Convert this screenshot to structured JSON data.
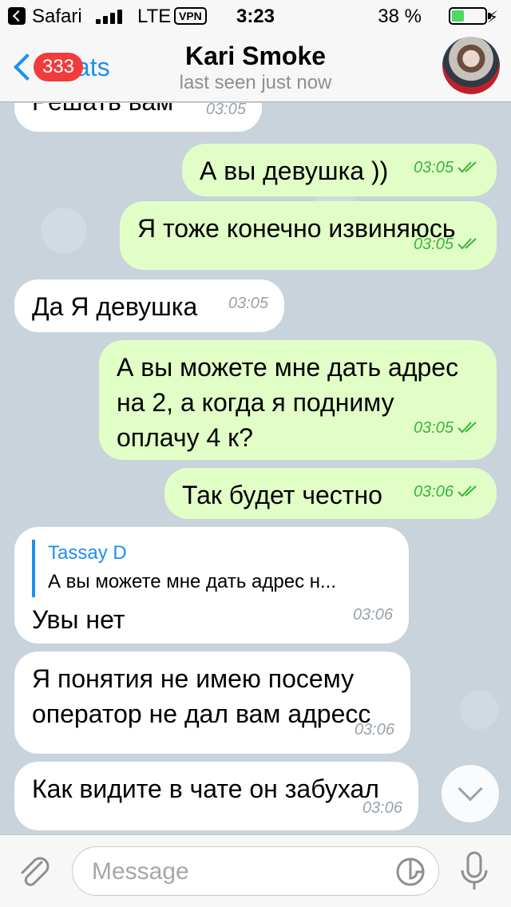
{
  "status_bar": {
    "app": "Safari",
    "network": "LTE",
    "vpn": "VPN",
    "time": "3:23",
    "battery_percent": "38 %",
    "battery_level": 0.38,
    "icons": [
      "back-to-app-icon",
      "signal-icon",
      "battery-icon",
      "charging-icon"
    ]
  },
  "nav": {
    "back_label": "Chats",
    "badge": "333",
    "title": "Kari Smoke",
    "subtitle": "last seen just now"
  },
  "messages": [
    {
      "dir": "in",
      "text": "Решать вам",
      "time": "03:05"
    },
    {
      "dir": "out",
      "text": "А вы девушка ))",
      "time": "03:05"
    },
    {
      "dir": "out",
      "text": "Я тоже конечно извиняюсь",
      "time": "03:05"
    },
    {
      "dir": "in",
      "text": "Да Я девушка",
      "time": "03:05"
    },
    {
      "dir": "out",
      "text": "А вы можете мне дать адрес\nна 2, а когда я подниму\nоплачу 4 к?",
      "time": "03:05"
    },
    {
      "dir": "out",
      "text": "Так будет честно",
      "time": "03:06"
    },
    {
      "dir": "in",
      "reply_name": "Tassay D",
      "reply_text": "А вы можете мне дать адрес н...",
      "text": "Увы нет",
      "time": "03:06"
    },
    {
      "dir": "in",
      "text": "Я понятия не имею посему\nоператор не дал вам адресс",
      "time": "03:06"
    },
    {
      "dir": "in",
      "text": "Как видите в чате он забухал",
      "time": "03:06"
    }
  ],
  "input": {
    "placeholder": "Message",
    "value": ""
  },
  "colors": {
    "accent": "#1f8ef1",
    "outgoing_bubble": "#e1fec6",
    "incoming_bubble": "#ffffff",
    "read_check": "#3cb33e",
    "badge": "#f23c3c",
    "chat_background": "#c8d3dc"
  }
}
